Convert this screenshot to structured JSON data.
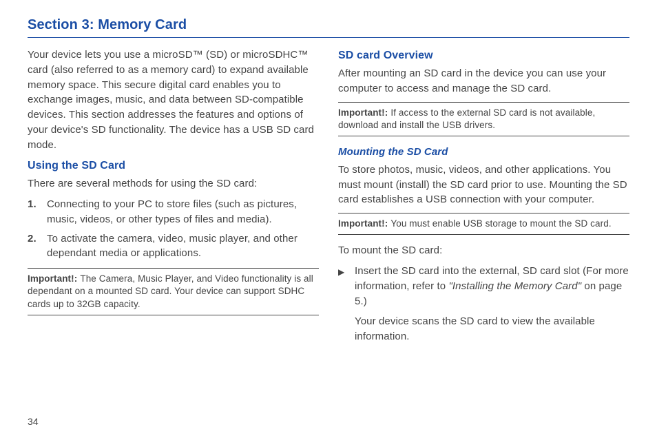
{
  "title": "Section 3: Memory Card",
  "intro": "Your device lets you use a microSD™ (SD) or microSDHC™ card (also referred to as a memory card) to expand available memory space. This secure digital card enables you to exchange images, music, and data between SD-compatible devices. This section addresses the features and options of your device's SD functionality. The device has a USB SD card mode.",
  "using_heading": "Using the SD Card",
  "using_intro": "There are several methods for using the SD card:",
  "using_items": {
    "i1_num": "1.",
    "i1": "Connecting to your PC to store files (such as pictures, music, videos, or other types of files and media).",
    "i2_num": "2.",
    "i2": "To activate the camera, video, music player, and other dependant media or applications."
  },
  "important_label": "Important!:",
  "important1": "The Camera, Music Player, and Video functionality is all dependant on a mounted SD card. Your device can support SDHC cards up to 32GB capacity.",
  "overview_heading": "SD card Overview",
  "overview_text": "After mounting an SD card in the device you can use your computer to access and manage the SD card.",
  "important2": "If access to the external SD card is not available, download and install the USB drivers.",
  "mounting_heading": "Mounting the SD Card",
  "mounting_text": "To store photos, music, videos, and other applications. You must mount (install) the SD card prior to use. Mounting the SD card establishes a USB connection with your computer.",
  "important3": "You must enable USB storage to mount the SD card.",
  "mount_intro": "To mount the SD card:",
  "mount_step_a": "Insert the SD card into the external, SD card slot (For more information, refer to ",
  "mount_ref": "\"Installing the Memory Card\"",
  "mount_step_b": " on page 5.)",
  "mount_result": "Your device scans the SD card to view the available information.",
  "page": "34"
}
